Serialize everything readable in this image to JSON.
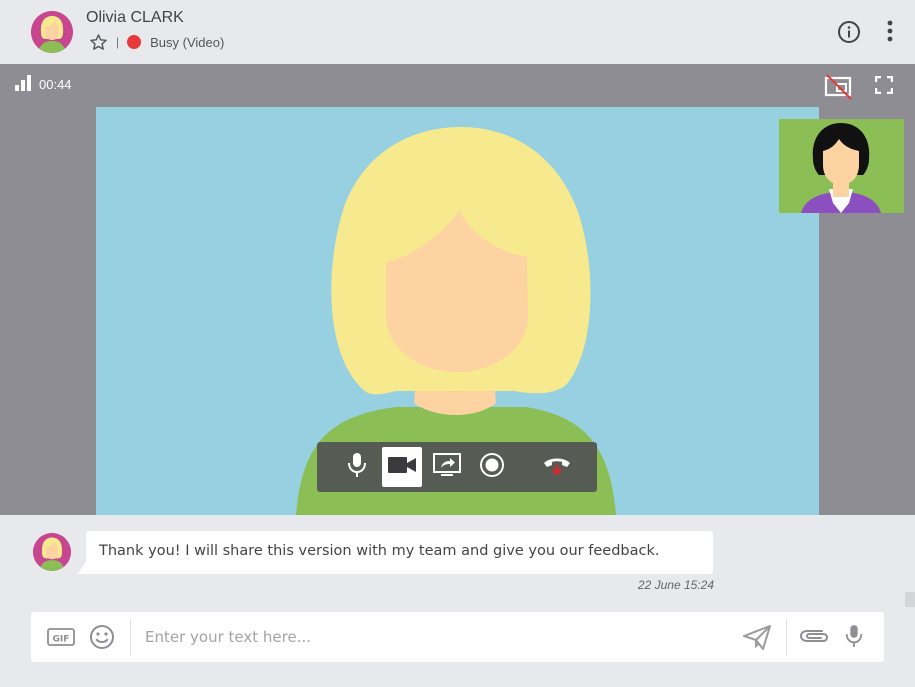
{
  "contact": {
    "name": "Olivia CLARK",
    "separator": "|",
    "status": "Busy (Video)"
  },
  "colors": {
    "status_busy": "#e8393d",
    "callbar_bg": "#8e8d93",
    "remote_bg": "#97d1e1",
    "self_bg": "#8cbe56",
    "hangup_red": "#d9292e"
  },
  "call": {
    "timer": "00:44"
  },
  "icons": {
    "header": [
      "star-icon",
      "info-icon",
      "more-vertical-icon"
    ],
    "callbar": [
      "signal-icon",
      "hide-self-view-icon",
      "fullscreen-icon"
    ],
    "controls": [
      "microphone-icon",
      "camera-icon",
      "screen-share-icon",
      "record-icon",
      "hang-up-icon"
    ],
    "composer": [
      "gif-icon",
      "emoji-icon",
      "send-icon",
      "attach-icon",
      "microphone-icon"
    ]
  },
  "controls": {
    "active": "camera"
  },
  "message": {
    "text": "Thank you! I will share this version with my team and give you our feedback.",
    "timestamp": "22 June 15:24"
  },
  "composer": {
    "placeholder": "Enter your text here..."
  }
}
